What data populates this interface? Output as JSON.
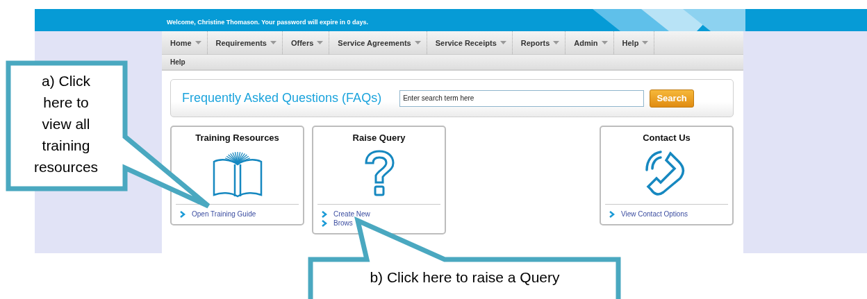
{
  "header": {
    "welcome": "Welcome, Christine Thomason. Your password will expire in 0 days."
  },
  "nav": [
    "Home",
    "Requirements",
    "Offers",
    "Service Agreements",
    "Service Receipts",
    "Reports",
    "Admin",
    "Help"
  ],
  "subnav": {
    "title": "Help"
  },
  "faq": {
    "title": "Frequently Asked Questions (FAQs)",
    "placeholder": "Enter search term here",
    "button": "Search"
  },
  "cards": [
    {
      "title": "Training Resources",
      "kind": "book",
      "links": [
        "Open Training Guide"
      ]
    },
    {
      "title": "Raise Query",
      "kind": "question",
      "links": [
        "Create New",
        "Brows"
      ]
    },
    {
      "title": "Contact Us",
      "kind": "phone",
      "links": [
        "View Contact Options"
      ]
    }
  ],
  "callouts": [
    {
      "text": "a) Click here to view all training resources"
    },
    {
      "text": "b) Click here to raise a Query"
    }
  ]
}
